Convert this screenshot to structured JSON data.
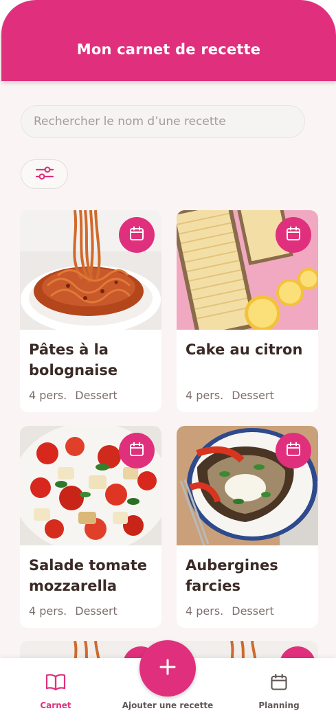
{
  "app": {
    "title": "Mon carnet de recette"
  },
  "search": {
    "placeholder": "Rechercher le nom d’une recette"
  },
  "filter": {
    "icon": "sliders-icon"
  },
  "recipes": [
    {
      "title": "Pâtes à la bolognaise",
      "servings": "4 pers.",
      "category": "Dessert",
      "image": "spaghetti-bolognese"
    },
    {
      "title": "Cake au citron",
      "servings": "4 pers.",
      "category": "Dessert",
      "image": "lemon-cake"
    },
    {
      "title": "Salade tomate mozzarella",
      "servings": "4 pers.",
      "category": "Dessert",
      "image": "tomato-mozzarella-salad"
    },
    {
      "title": "Aubergines farcies",
      "servings": "4 pers.",
      "category": "Dessert",
      "image": "stuffed-eggplant"
    }
  ],
  "nav": {
    "carnet": "Carnet",
    "add": "Ajouter une recette",
    "planning": "Planning"
  },
  "colors": {
    "accent": "#e0307d",
    "background": "#faf4f4",
    "text": "#3a2a26",
    "muted": "#7b706d"
  }
}
